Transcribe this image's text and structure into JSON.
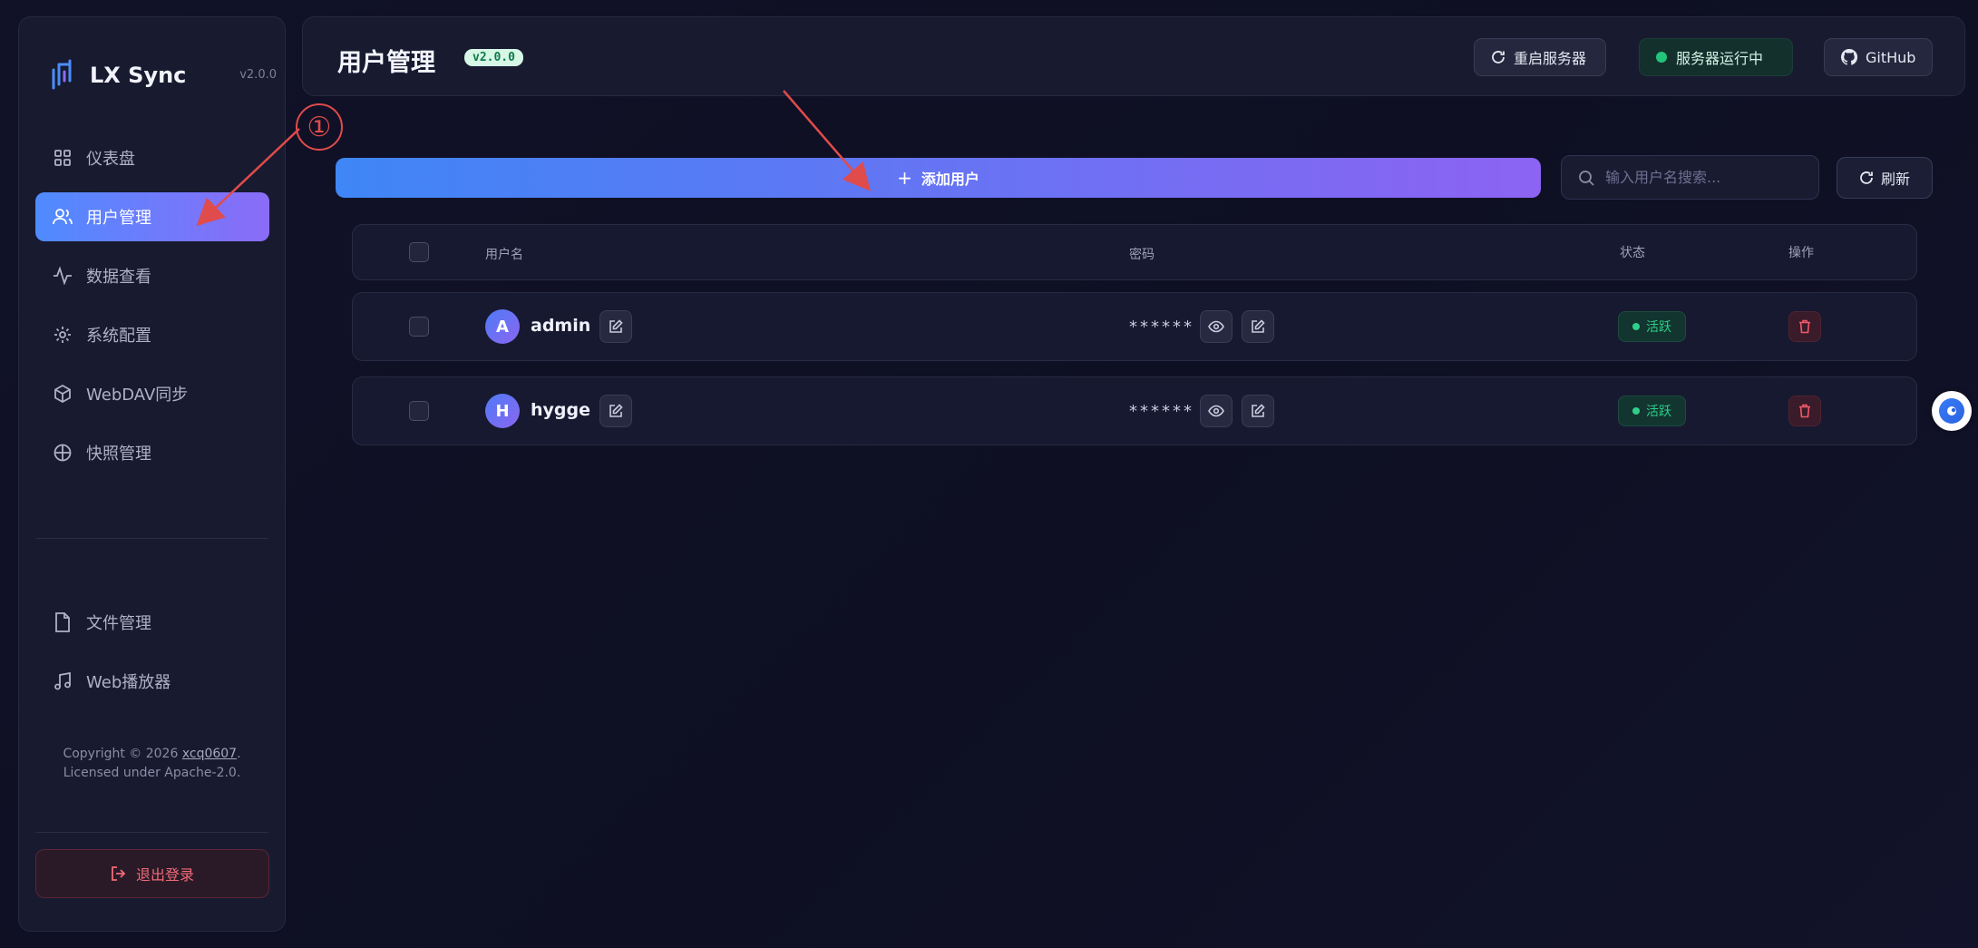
{
  "brand": {
    "name": "LX Sync",
    "version": "v2.0.0"
  },
  "sidebar": {
    "items": [
      {
        "label": "仪表盘",
        "icon": "dashboard-icon"
      },
      {
        "label": "用户管理",
        "icon": "users-icon",
        "active": true
      },
      {
        "label": "数据查看",
        "icon": "activity-icon"
      },
      {
        "label": "系统配置",
        "icon": "settings-icon"
      },
      {
        "label": "WebDAV同步",
        "icon": "cube-icon"
      },
      {
        "label": "快照管理",
        "icon": "snapshot-icon"
      }
    ],
    "items2": [
      {
        "label": "文件管理",
        "icon": "file-icon"
      },
      {
        "label": "Web播放器",
        "icon": "music-icon"
      }
    ],
    "copyright_prefix": "Copyright © 2026 ",
    "copyright_author": "xcq0607",
    "copyright_suffix": ".",
    "license": "Licensed under Apache-2.0.",
    "logout_label": "退出登录"
  },
  "header": {
    "title": "用户管理",
    "version_badge": "v2.0.0",
    "restart_label": "重启服务器",
    "status_label": "服务器运行中",
    "github_label": "GitHub"
  },
  "toolbar": {
    "add_user_label": "添加用户",
    "search_placeholder": "输入用户名搜索...",
    "refresh_label": "刷新"
  },
  "table": {
    "columns": {
      "username": "用户名",
      "password": "密码",
      "status": "状态",
      "actions": "操作"
    },
    "rows": [
      {
        "initial": "A",
        "username": "admin",
        "password_mask": "******",
        "status": "活跃"
      },
      {
        "initial": "H",
        "username": "hygge",
        "password_mask": "******",
        "status": "活跃"
      }
    ]
  },
  "annotations": {
    "step_marker": "①"
  },
  "colors": {
    "accent_start": "#3f86f6",
    "accent_end": "#8c63f2",
    "status_green": "#22c47a",
    "danger": "#f06a78",
    "annotation_red": "#e04b4b"
  }
}
